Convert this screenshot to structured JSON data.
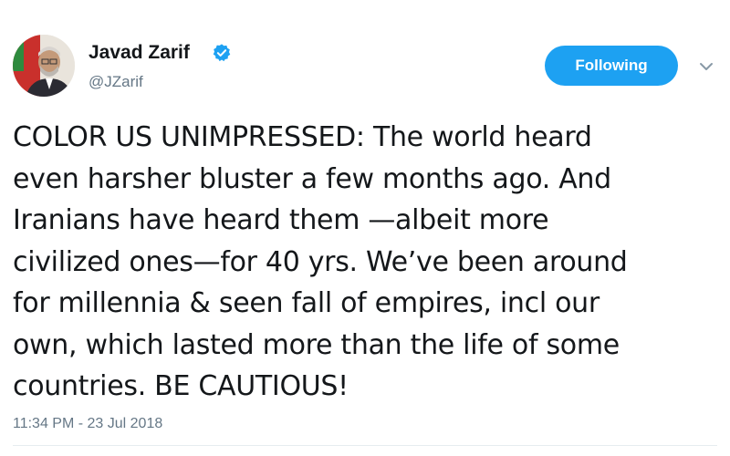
{
  "author": {
    "display_name": "Javad Zarif",
    "handle": "@JZarif",
    "verified": true,
    "avatar_icon": "profile-photo"
  },
  "follow_button": {
    "label": "Following"
  },
  "menu": {
    "icon": "chevron-down-icon"
  },
  "tweet": {
    "lines": [
      "COLOR US UNIMPRESSED: The world heard",
      "even harsher bluster a few months ago. And",
      "Iranians have heard them —albeit more",
      "civilized ones—for 40 yrs. We’ve been around",
      "for millennia & seen fall of empires, incl our",
      "own, which lasted more than the life of some",
      "countries. BE CAUTIOUS!"
    ],
    "timestamp": "11:34 PM - 23 Jul 2018"
  },
  "colors": {
    "accent": "#1da1f2",
    "text": "#14171a",
    "secondary_text": "#657786"
  }
}
